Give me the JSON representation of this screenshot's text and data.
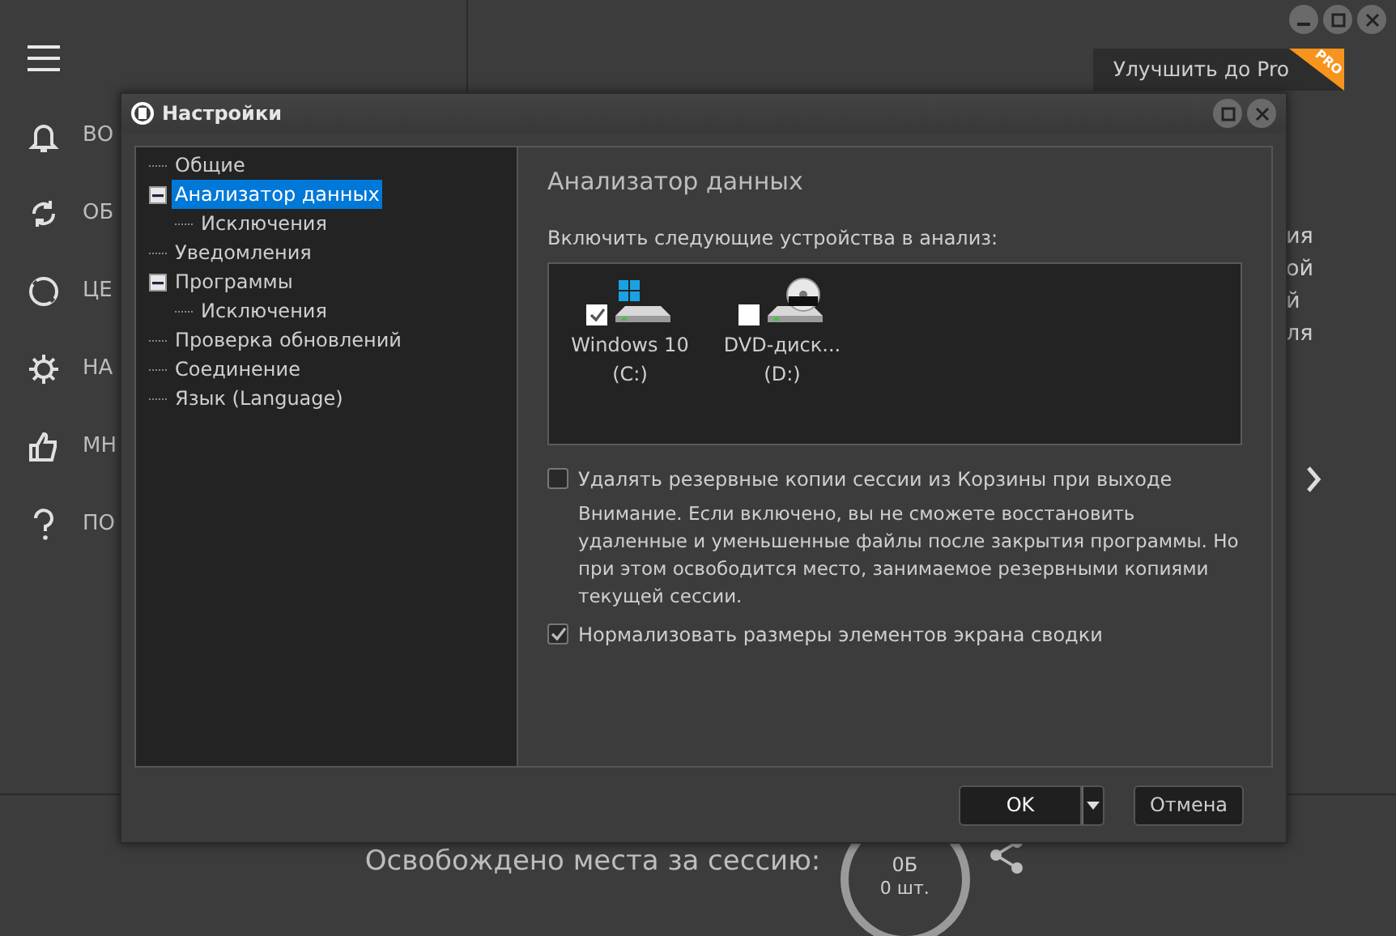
{
  "sidebar": {
    "items": [
      {
        "label": "ВО"
      },
      {
        "label": "ОБ"
      },
      {
        "label": "ЦЕ"
      },
      {
        "label": "НА"
      },
      {
        "label": "МН"
      },
      {
        "label": "ПО"
      }
    ]
  },
  "upgrade": {
    "label": "Улучшить до Pro",
    "ribbon": "PRO"
  },
  "background_text": [
    "ия",
    "ой",
    "й",
    "ля"
  ],
  "session": {
    "label": "Освобождено места за сессию:",
    "size": "0Б",
    "count": "0 шт."
  },
  "dialog": {
    "title": "Настройки",
    "tree": [
      {
        "label": "Общие",
        "selected": false
      },
      {
        "label": "Анализатор данных",
        "selected": true,
        "expanded": true,
        "children": [
          {
            "label": "Исключения",
            "selected": false
          }
        ]
      },
      {
        "label": "Уведомления",
        "selected": false
      },
      {
        "label": "Программы",
        "selected": false,
        "expanded": true,
        "children": [
          {
            "label": "Исключения",
            "selected": false
          }
        ]
      },
      {
        "label": "Проверка обновлений",
        "selected": false
      },
      {
        "label": "Соединение",
        "selected": false
      },
      {
        "label": "Язык (Language)",
        "selected": false
      }
    ],
    "heading": "Анализатор данных",
    "devices_label": "Включить следующие устройства в анализ:",
    "devices": [
      {
        "kind": "system",
        "name": "Windows 10",
        "drive": "(C:)",
        "checked": true
      },
      {
        "kind": "dvd",
        "name": "DVD-диск...",
        "drive": "(D:)",
        "checked": false
      }
    ],
    "options": [
      {
        "label": "Удалять резервные копии сессии из Корзины при выходе",
        "checked": false,
        "note": "Внимание. Если включено, вы не сможете восстановить удаленные и уменьшенные файлы после закрытия программы. Но при этом освободится место, занимаемое резервными копиями текущей сессии."
      },
      {
        "label": "Нормализовать размеры элементов экрана сводки",
        "checked": true
      }
    ],
    "buttons": [
      {
        "kind": "split",
        "label": "OK"
      },
      {
        "kind": "plain",
        "label": "Отмена"
      }
    ]
  }
}
